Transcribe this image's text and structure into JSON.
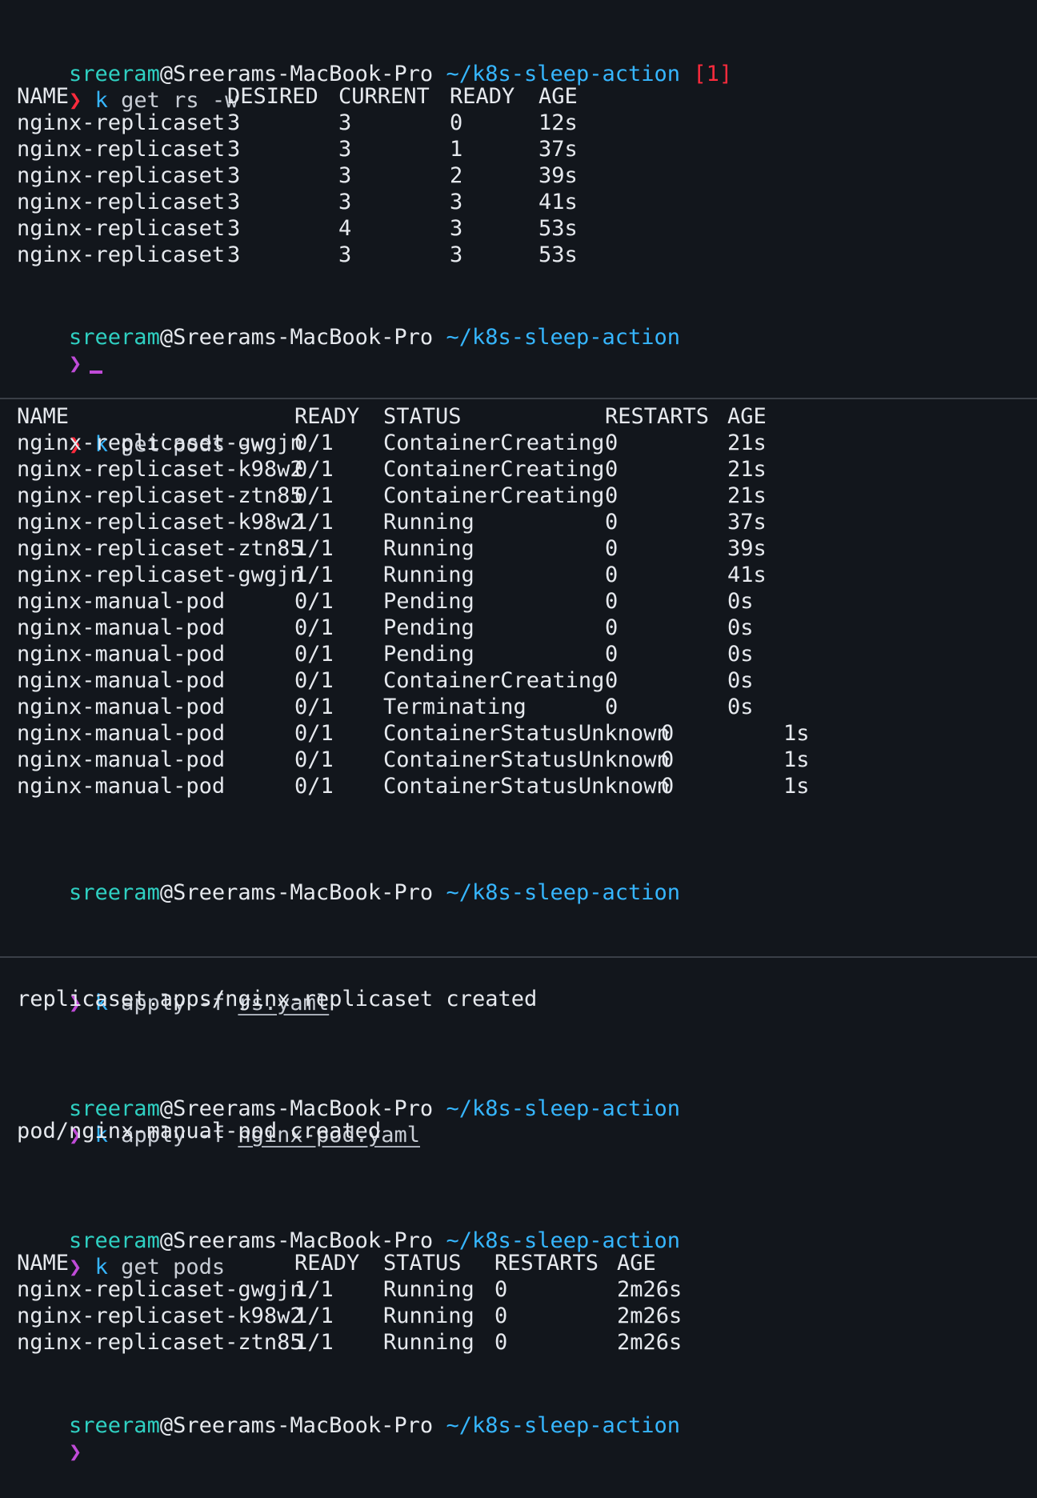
{
  "prompt": {
    "user": "sreeram",
    "at_host": "@Sreerams-MacBook-Pro",
    "path": "~/k8s-sleep-action",
    "exit_status": "[1]",
    "symbol": "❯"
  },
  "pane1": {
    "command": {
      "k": "k",
      "args": "get rs -w"
    },
    "columns": [
      "NAME",
      "DESIRED",
      "CURRENT",
      "READY",
      "AGE"
    ],
    "rows": [
      [
        "nginx-replicaset",
        "3",
        "3",
        "0",
        "12s"
      ],
      [
        "nginx-replicaset",
        "3",
        "3",
        "1",
        "37s"
      ],
      [
        "nginx-replicaset",
        "3",
        "3",
        "2",
        "39s"
      ],
      [
        "nginx-replicaset",
        "3",
        "3",
        "3",
        "41s"
      ],
      [
        "nginx-replicaset",
        "3",
        "4",
        "3",
        "53s"
      ],
      [
        "nginx-replicaset",
        "3",
        "3",
        "3",
        "53s"
      ]
    ]
  },
  "pane2": {
    "command": {
      "k": "k",
      "args": "get pods -w"
    },
    "columns": [
      "NAME",
      "READY",
      "STATUS",
      "RESTARTS",
      "AGE"
    ],
    "rows": [
      [
        "nginx-replicaset-gwgjn",
        "0/1",
        "ContainerCreating",
        "0",
        "21s"
      ],
      [
        "nginx-replicaset-k98w2",
        "0/1",
        "ContainerCreating",
        "0",
        "21s"
      ],
      [
        "nginx-replicaset-ztn85",
        "0/1",
        "ContainerCreating",
        "0",
        "21s"
      ],
      [
        "nginx-replicaset-k98w2",
        "1/1",
        "Running",
        "0",
        "37s"
      ],
      [
        "nginx-replicaset-ztn85",
        "1/1",
        "Running",
        "0",
        "39s"
      ],
      [
        "nginx-replicaset-gwgjn",
        "1/1",
        "Running",
        "0",
        "41s"
      ],
      [
        "nginx-manual-pod",
        "0/1",
        "Pending",
        "0",
        "0s"
      ],
      [
        "nginx-manual-pod",
        "0/1",
        "Pending",
        "0",
        "0s"
      ],
      [
        "nginx-manual-pod",
        "0/1",
        "Pending",
        "0",
        "0s"
      ],
      [
        "nginx-manual-pod",
        "0/1",
        "ContainerCreating",
        "0",
        "0s"
      ],
      [
        "nginx-manual-pod",
        "0/1",
        "Terminating",
        "0",
        "0s"
      ],
      [
        "nginx-manual-pod",
        "0/1",
        "ContainerStatusUnknown",
        "0",
        "1s"
      ],
      [
        "nginx-manual-pod",
        "0/1",
        "ContainerStatusUnknown",
        "0",
        "1s"
      ],
      [
        "nginx-manual-pod",
        "0/1",
        "ContainerStatusUnknown",
        "0",
        "1s"
      ]
    ]
  },
  "pane3": {
    "cmd1": {
      "k": "k",
      "args": "apply -f ",
      "file": "rs.yaml"
    },
    "out1": "replicaset.apps/nginx-replicaset created",
    "cmd2": {
      "k": "k",
      "args": "apply -f ",
      "file": "nginx-pod.yaml"
    },
    "out2": "pod/nginx-manual-pod created",
    "cmd3": {
      "k": "k",
      "args": "get pods"
    },
    "columns": [
      "NAME",
      "READY",
      "STATUS",
      "RESTARTS",
      "AGE"
    ],
    "rows": [
      [
        "nginx-replicaset-gwgjn",
        "1/1",
        "Running",
        "0",
        "2m26s"
      ],
      [
        "nginx-replicaset-k98w2",
        "1/1",
        "Running",
        "0",
        "2m26s"
      ],
      [
        "nginx-replicaset-ztn85",
        "1/1",
        "Running",
        "0",
        "2m26s"
      ]
    ]
  },
  "colors": {
    "background": "#12161c",
    "user": "#2fd0c2",
    "path": "#36b6ff",
    "error": "#ff2b3d",
    "chevron_ok": "#c04bd8"
  }
}
